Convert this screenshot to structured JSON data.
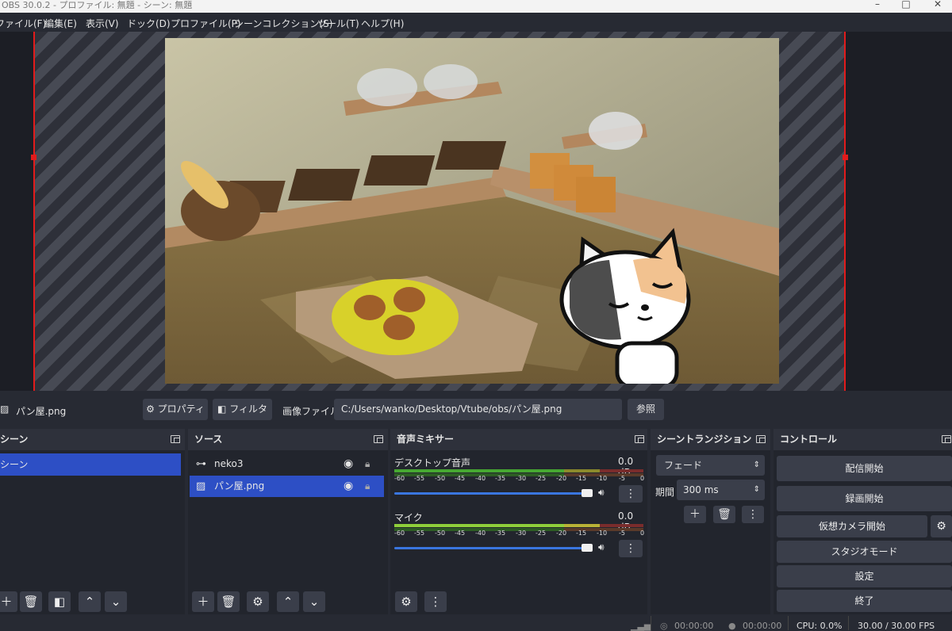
{
  "window": {
    "title": "OBS 30.0.2 - プロファイル: 無題 - シーン: 無題"
  },
  "menu": [
    "ファイル(F)",
    "編集(E)",
    "表示(V)",
    "ドック(D)",
    "プロファイル(P)",
    "シーンコレクション(S)",
    "ツール(T)",
    "ヘルプ(H)"
  ],
  "source_bar": {
    "selected_source": "パン屋.png",
    "properties_label": "プロパティ",
    "filters_label": "フィルタ",
    "image_file_label": "画像ファイル",
    "path": "C:/Users/wanko/Desktop/Vtube/obs/パン屋.png",
    "browse_label": "参照"
  },
  "scenes": {
    "title": "シーン",
    "items": [
      "シーン"
    ]
  },
  "sources": {
    "title": "ソース",
    "items": [
      "neko3",
      "パン屋.png"
    ]
  },
  "mixer": {
    "title": "音声ミキサー",
    "channels": [
      {
        "name": "デスクトップ音声",
        "level": "0.0 dB"
      },
      {
        "name": "マイク",
        "level": "0.0 dB"
      }
    ],
    "scale": [
      "-60",
      "-55",
      "-50",
      "-45",
      "-40",
      "-35",
      "-30",
      "-25",
      "-20",
      "-15",
      "-10",
      "-5",
      "0"
    ]
  },
  "transitions": {
    "title": "シーントランジション",
    "selected": "フェード",
    "duration_label": "期間",
    "duration_value": "300 ms"
  },
  "controls": {
    "title": "コントロール",
    "start_streaming": "配信開始",
    "start_recording": "録画開始",
    "start_virtual_camera": "仮想カメラ開始",
    "studio_mode": "スタジオモード",
    "settings": "設定",
    "exit": "終了"
  },
  "status": {
    "stream_time": "00:00:00",
    "record_time": "00:00:00",
    "cpu": "CPU: 0.0%",
    "fps": "30.00 / 30.00 FPS"
  },
  "colors": {
    "accent": "#2d4fc5",
    "selection_red": "#e21b1b",
    "panel": "#22252d",
    "button": "#3a3e4a"
  }
}
